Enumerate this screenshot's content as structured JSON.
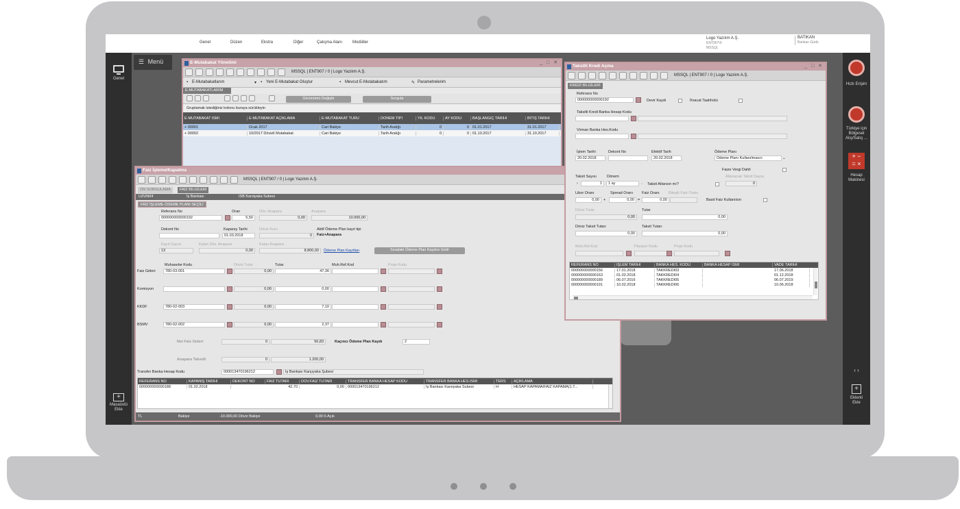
{
  "menubar": {
    "items": [
      "Genel",
      "Düzen",
      "Ekstra",
      "Diğer",
      "Çalışma Alanı",
      "Modüller"
    ],
    "company": "Logo Yazılım A.Ş.",
    "company_sub1": "ENT907\\0",
    "company_sub2": "MSSQL",
    "user": "BATIKAN",
    "user_sub": "Batıkan Güdü"
  },
  "left_rail": {
    "genel_label": "Genel",
    "masaustu_label1": "Masaüstü",
    "masaustu_label2": "Ekle"
  },
  "menu_button": {
    "label": "Menü"
  },
  "right_rail": {
    "hizli_erisim": "Hızlı Erişim",
    "bolgesel1": "Türkiye için",
    "bolgesel2": "Bölgesel",
    "bolgesel3": "Alış/Satış ...",
    "hesap1": "Hesap",
    "hesap2": "Makinesi",
    "nav": "‹  ›",
    "ekle1": "Eklenti",
    "ekle2": "Ekle"
  },
  "emutabakat": {
    "title": "E-Mutabakat Yönetimi",
    "db_info": "MSSQL | ENT907 / 0 | Logo Yazılım A.Ş.",
    "btn_list": "E-Mutabakatlarım",
    "btn_new": "Yeni E-Mutabakat Oluştur",
    "btn_existing": "Mevcut E-Mutabakatım",
    "btn_params": "Parametrelerim",
    "tab": "E-MUTABAKATLARIM",
    "btn_view": "Görünümü Değiştir",
    "btn_query": "Sorgula",
    "group_hint": "Gruplamak istediğiniz kolonu buraya sürükleyin",
    "columns": [
      "E-MUTABAKAT İSMİ",
      "E-MUTABAKAT AÇIKLAMA",
      "E-MUTABAKAT TÜRÜ",
      "DÖNEM TİPİ",
      "YIL KODU",
      "AY KODU",
      "BAŞLANGIÇ TARİHİ",
      "BİTİŞ TARİHİ"
    ],
    "rows": [
      [
        "+ 00001",
        "Ocak 2017",
        "Cari Bakiye",
        "Tarih Aralığı",
        "0",
        "0",
        "01.01.2017",
        "31.01.2017"
      ],
      [
        "+ 00002",
        "10/2017 Dövizli Mutabakat",
        "Cari Bakiye",
        "Tarih Aralığı",
        "0",
        "0",
        "01.10.2017",
        "31.10.2017"
      ]
    ]
  },
  "faiz": {
    "title": "Faiz İşleme/Kapatma",
    "db_info": "MSSQL | ENT907 / 0 | Logo Yazılım A.Ş.",
    "tab1": "ÖN SORGULAMA",
    "tab2": "FAİZ BİLGİLERİ",
    "bar_code": "UZUN04",
    "bar_bank": "İş Bankası",
    "bar_branch": "ISB Karsiyaka Subesi",
    "plan_tab": "FAİZ İŞLEME-ÖDEME PLANI SEÇİLİ",
    "ref_label": "Referans No",
    "ref_value": "000000000000192",
    "oran_label": "Oran",
    "oran_value": "5,50",
    "dov_anapara_label": "Döv. Anapara",
    "dov_anapara_value": "0,00",
    "anapara_label": "Anapara",
    "anapara_value": "10.000,00",
    "dekont_label": "Dekont No",
    "kapanis_label": "Kapanış Tarihi",
    "kapanis_value": "01.03.2018",
    "doviz_kuru_label": "Döviz Kuru",
    "doviz_kuru_value": "0",
    "aktif_label": "Aktif Ödeme Plan kayıt tipi",
    "aktif_value": "Faiz+Anapara",
    "kayit_sayisi_label": "Kayıt Sayısı",
    "kayit_sayisi_value": "13",
    "kalan_dov_label": "Kalan Döv. Anapara",
    "kalan_dov_value": "0,00",
    "kalan_anapara_label": "Kalan Anapara",
    "kalan_anapara_value": "8.800,00",
    "odeme_link": "Ödeme Plan Kayıtları",
    "siradaki_btn": "Sıradaki Ödeme Plan Kaydını Getir",
    "col_muhasebe": "Muhasebe Kodu",
    "col_doviz_tutar": "Döviz Tutar",
    "col_tutar": "Tutar",
    "col_muh_ref": "Muh.Ref.Kod",
    "col_proje": "Proje Kodu",
    "lines": [
      {
        "label": "Faiz Gideri",
        "code": "780-03-001",
        "doviz": "0,00",
        "tutar": "47,36"
      },
      {
        "label": "Komisyon",
        "code": "",
        "doviz": "0,00",
        "tutar": "0,00"
      },
      {
        "label": "KKDF",
        "code": "780-02-003",
        "doviz": "0,00",
        "tutar": "7,10"
      },
      {
        "label": "BSMV",
        "code": "780-02-002",
        "doviz": "0,00",
        "tutar": "2,37"
      }
    ],
    "net_faiz_label": "Net Faiz Gideri",
    "net_faiz_doviz": "0",
    "net_faiz_value": "56,83",
    "kacinci_label": "Kaçıncı Ödeme Plan Kaydı",
    "kacinci_value": "2",
    "anapara_taksidi_label": "Anapara Taksidi",
    "anapara_taksidi_doviz": "0",
    "anapara_taksidi_value": "1.200,00",
    "transfer_label": "Transfer Banka Hesap Kodu",
    "transfer_value": "000013470196212",
    "transfer_desc": "İş Bankası Karşıyaka Şubesi",
    "grid_columns": [
      "REFERANS NO",
      "KAPANIŞ TARİHİ",
      "DEKONT NO",
      "FAİZ TUTARI",
      "DÖV.FAİZ TUTARI",
      "TRANSFER BANKA HESAP KODU",
      "TRANSFER BANKA HES.İSMİ",
      "TERS",
      "AÇIKLAMA"
    ],
    "grid_rows": [
      [
        "000000000000188",
        "01.02.2018",
        "",
        "42,70",
        "0,00",
        "000013470196212",
        "İş Bankası Karsiyaka Subesi",
        "H",
        "HESAP KAPAMA/FAİZ KAPAMA(1.T..."
      ]
    ],
    "footer_tl": "TL",
    "footer_bakiye": "Bakiye",
    "footer_doviz": "-10.000,00 Döviz Bakiye",
    "footer_acik": "0,00 0-Açık"
  },
  "taksitli": {
    "title": "Taksitli Kredi Açma",
    "db_info": "MSSQL | ENT907 / 0 | Logo Yazılım A.Ş.",
    "tab": "KREDİ BİLGİLERİ",
    "ref_label": "Referans No",
    "ref_value": "000000000000192",
    "devir_label": "Devir Kaydı",
    "ihracat_label": "İhracat Taahhütü",
    "banka_hesap_label": "Taksitli Kredi Banka Hesap Kodu",
    "virman_label": "Virman Banka Hes.Kodu",
    "islem_tarihi_label": "İşlem Tarihi",
    "islem_tarihi_value": "20.02.2018",
    "dekont_label": "Dekont No",
    "efektif_label": "Efektif Tarih",
    "efektif_value": "20.02.2018",
    "odeme_plani_label": "Ödeme Planı",
    "odeme_plani_value": "Ödeme Planı Kullanılmasın",
    "faize_vergi_label": "Faize Vergi Dahil",
    "taksit_sayisi_label": "Taksit Sayısı",
    "taksit_sayisi_value": "1",
    "donem_label": "Dönem",
    "donem_value": "1 ay",
    "taksit_atlansin_label": "Taksit Atlansın mı?",
    "atlanacak_label": "Atlanacak Taksit Sayısı",
    "atlanacak_value": "0",
    "libor_label": "Libor Oranı",
    "libor_value": "0,00",
    "spread_label": "Spread Oranı",
    "spread_value": "0,00",
    "faiz_orani_label": "Faiz Oranı",
    "faiz_orani_value": "0,00",
    "bilesik_label": "Bileşik Faiz Oranı",
    "basit_label": "Basit Faiz Kullanılsın",
    "doviz_tutar_label": "Döviz Tutar",
    "doviz_tutar_value": "0,00",
    "tutar_label": "Tutar",
    "tutar_value": "0,00",
    "doviz_taksit_label": "Döviz Taksit Tutarı",
    "doviz_taksit_value": "0,00",
    "taksit_tutari_label": "Taksit Tutarı",
    "taksit_tutari_value": "0,00",
    "muh_ref_label": "Muh.Ref.Kod",
    "plasiyer_label": "Plasiyer Kodu",
    "proje_label": "Proje Kodu",
    "grid_columns": [
      "REFERANS NO",
      "İŞLEM TARİHİ",
      "BANKA HES. KODU",
      "BANKA HESAP İSMİ",
      "VADE TARİHİ"
    ],
    "grid_rows": [
      [
        "000000000000156",
        "17.01.2018",
        "TAKKREDI03",
        "",
        "17.06.2018"
      ],
      [
        "000000000000163",
        "01.02.2018",
        "TAKKREDI04",
        "",
        "01.12.2018"
      ],
      [
        "000000000000189",
        "06.07.2016",
        "TAKKREDI05",
        "",
        "06.07.2019"
      ],
      [
        "000000000000191",
        "10.02.2018",
        "TAKKREDI06",
        "",
        "10.06.2018"
      ]
    ]
  }
}
